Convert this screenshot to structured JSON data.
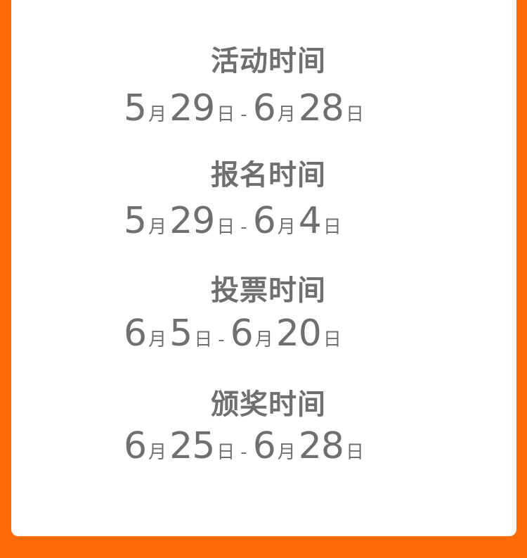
{
  "schedule": [
    {
      "label": "活动时间",
      "start_month": "5",
      "start_day": "29",
      "end_month": "6",
      "end_day": "28"
    },
    {
      "label": "报名时间",
      "start_month": "5",
      "start_day": "29",
      "end_month": "6",
      "end_day": "4"
    },
    {
      "label": "投票时间",
      "start_month": "6",
      "start_day": "5",
      "end_month": "6",
      "end_day": "20"
    },
    {
      "label": "颁奖时间",
      "start_month": "6",
      "start_day": "25",
      "end_month": "6",
      "end_day": "28"
    }
  ],
  "units": {
    "month": "月",
    "day": "日",
    "separator": "-"
  },
  "colors": {
    "border_orange": "#ff6a0b",
    "text_gray": "#6f6f6f",
    "card_white": "#ffffff"
  }
}
